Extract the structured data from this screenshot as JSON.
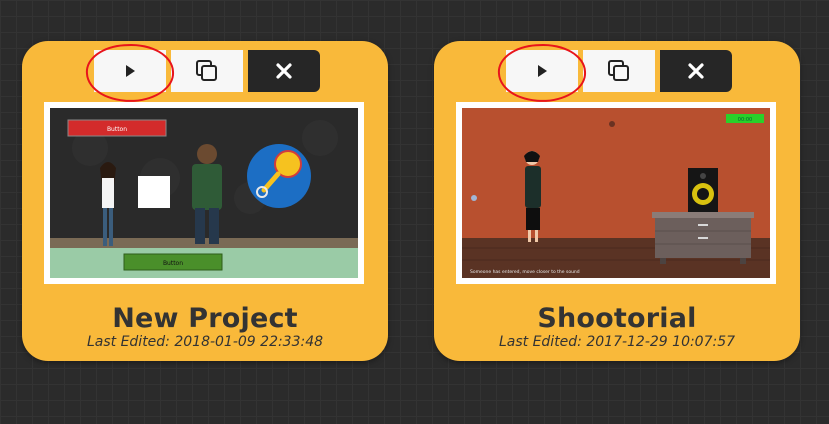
{
  "projects": [
    {
      "title": "New Project",
      "last_edited": "Last Edited: 2018-01-09 22:33:48",
      "thumbnail": {
        "top_button_label": "Button",
        "bottom_button_label": "Button"
      }
    },
    {
      "title": "Shootorial",
      "last_edited": "Last Edited: 2017-12-29 10:07:57",
      "thumbnail": {
        "badge_label": "00:00",
        "caption": "Someone has entered, move closer to the sound"
      }
    }
  ],
  "icons": {
    "play": "play-icon",
    "duplicate": "duplicate-icon",
    "delete": "close-icon"
  },
  "colors": {
    "card": "#f9b93a",
    "annotation_circle": "#e8141b",
    "delete_button": "#262626"
  }
}
